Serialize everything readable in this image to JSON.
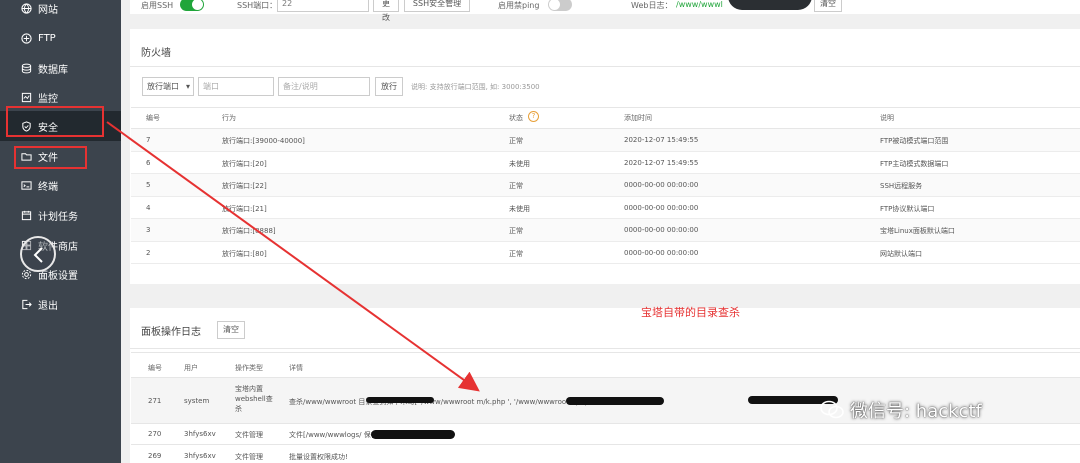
{
  "sidebar": {
    "items": [
      {
        "label": "网站",
        "icon": "globe-icon"
      },
      {
        "label": "FTP",
        "icon": "ftp-icon"
      },
      {
        "label": "数据库",
        "icon": "database-icon"
      },
      {
        "label": "监控",
        "icon": "monitor-icon"
      },
      {
        "label": "安全",
        "icon": "shield-icon"
      },
      {
        "label": "文件",
        "icon": "folder-icon"
      },
      {
        "label": "终端",
        "icon": "terminal-icon"
      },
      {
        "label": "计划任务",
        "icon": "calendar-icon"
      },
      {
        "label": "软件商店",
        "icon": "grid-icon"
      },
      {
        "label": "面板设置",
        "icon": "gear-icon"
      },
      {
        "label": "退出",
        "icon": "logout-icon"
      }
    ]
  },
  "topbar": {
    "ssh_enable_label": "启用SSH",
    "ssh_port_label": "SSH端口：",
    "ssh_port_value": "22",
    "change_btn": "更改",
    "ssh_manage_btn": "SSH安全管理",
    "ping_label": "启用禁ping",
    "weblog_label": "Web日志：",
    "weblog_path": "/www/wwwl",
    "clear_btn": "清空"
  },
  "firewall": {
    "title": "防火墙",
    "port_select": "放行端口",
    "port_placeholder": "端口",
    "note_placeholder": "备注/说明",
    "allow_btn": "放行",
    "hint": "说明: 支持放行端口范围, 如: 3000:3500",
    "columns": [
      "编号",
      "行为",
      "状态",
      "添加时间",
      "说明"
    ],
    "rows": [
      {
        "id": "7",
        "action": "放行端口:[39000-40000]",
        "status": "正常",
        "time": "2020-12-07 15:49:55",
        "note": "FTP被动模式端口范围"
      },
      {
        "id": "6",
        "action": "放行端口:[20]",
        "status": "未使用",
        "time": "2020-12-07 15:49:55",
        "note": "FTP主动模式数据端口"
      },
      {
        "id": "5",
        "action": "放行端口:[22]",
        "status": "正常",
        "time": "0000-00-00 00:00:00",
        "note": "SSH远程服务"
      },
      {
        "id": "4",
        "action": "放行端口:[21]",
        "status": "未使用",
        "time": "0000-00-00 00:00:00",
        "note": "FTP协议默认端口"
      },
      {
        "id": "3",
        "action": "放行端口:[8888]",
        "status": "正常",
        "time": "0000-00-00 00:00:00",
        "note": "宝塔Linux面板默认端口"
      },
      {
        "id": "2",
        "action": "放行端口:[80]",
        "status": "正常",
        "time": "0000-00-00 00:00:00",
        "note": "网站默认端口"
      }
    ]
  },
  "annotation": "宝塔自带的目录查杀",
  "oplog": {
    "title": "面板操作日志",
    "clear_btn": "清空",
    "columns": [
      "编号",
      "用户",
      "操作类型",
      "详情"
    ],
    "rows": [
      {
        "id": "271",
        "user": "system",
        "type": "宝塔内置webshell查杀",
        "detail": "查杀/www/wwwroot                    目录查到如下木马[   '/www/wwwroot                        m/k.php  ',   '/www/wwwroot/                               .php  ]"
      },
      {
        "id": "270",
        "user": "3hfys6xv",
        "type": "文件管理",
        "detail": "文件[/www/wwwlogs/                        保存成功!"
      },
      {
        "id": "269",
        "user": "3hfys6xv",
        "type": "文件管理",
        "detail": "批量设置权限成功!"
      }
    ]
  },
  "watermark": "微信号: hackctf",
  "colors": {
    "sidebar_bg": "#3c444d",
    "toggle_on": "#20a53a",
    "highlight_red": "#e63232"
  }
}
